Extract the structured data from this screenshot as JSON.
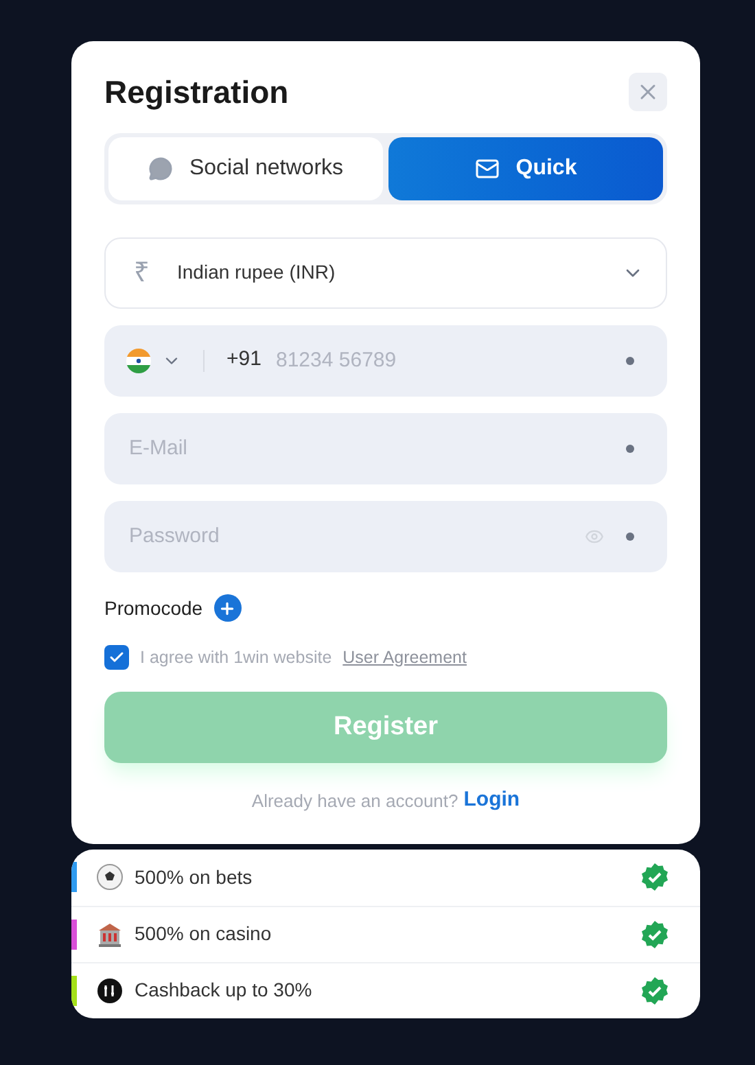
{
  "title": "Registration",
  "tabs": [
    {
      "label": "Social networks",
      "kind": "social",
      "selected": false
    },
    {
      "label": "Quick",
      "kind": "mail",
      "selected": true
    }
  ],
  "currency": {
    "symbol": "₹",
    "value": "Indian rupee (INR)"
  },
  "phone": {
    "prefix": "+91",
    "placeholder": "81234 56789"
  },
  "email": {
    "placeholder": "E-Mail"
  },
  "password": {
    "placeholder": "Password"
  },
  "promocode": {
    "label": "Promocode"
  },
  "agreement": {
    "text": "I agree with 1win website",
    "link": "User Agreement",
    "checked": true
  },
  "register": {
    "label": "Register",
    "disabled": true
  },
  "login": {
    "text": "Already have an account?",
    "link": "Login"
  },
  "bonuses": [
    {
      "kind": "ball",
      "text": "500% on bets",
      "color": "#2f9bf0"
    },
    {
      "kind": "casino",
      "text": "500% on casino",
      "color": "#d94fd8"
    },
    {
      "kind": "cashback",
      "text": "Cashback up to 30%",
      "color": "#a4e01a"
    }
  ]
}
